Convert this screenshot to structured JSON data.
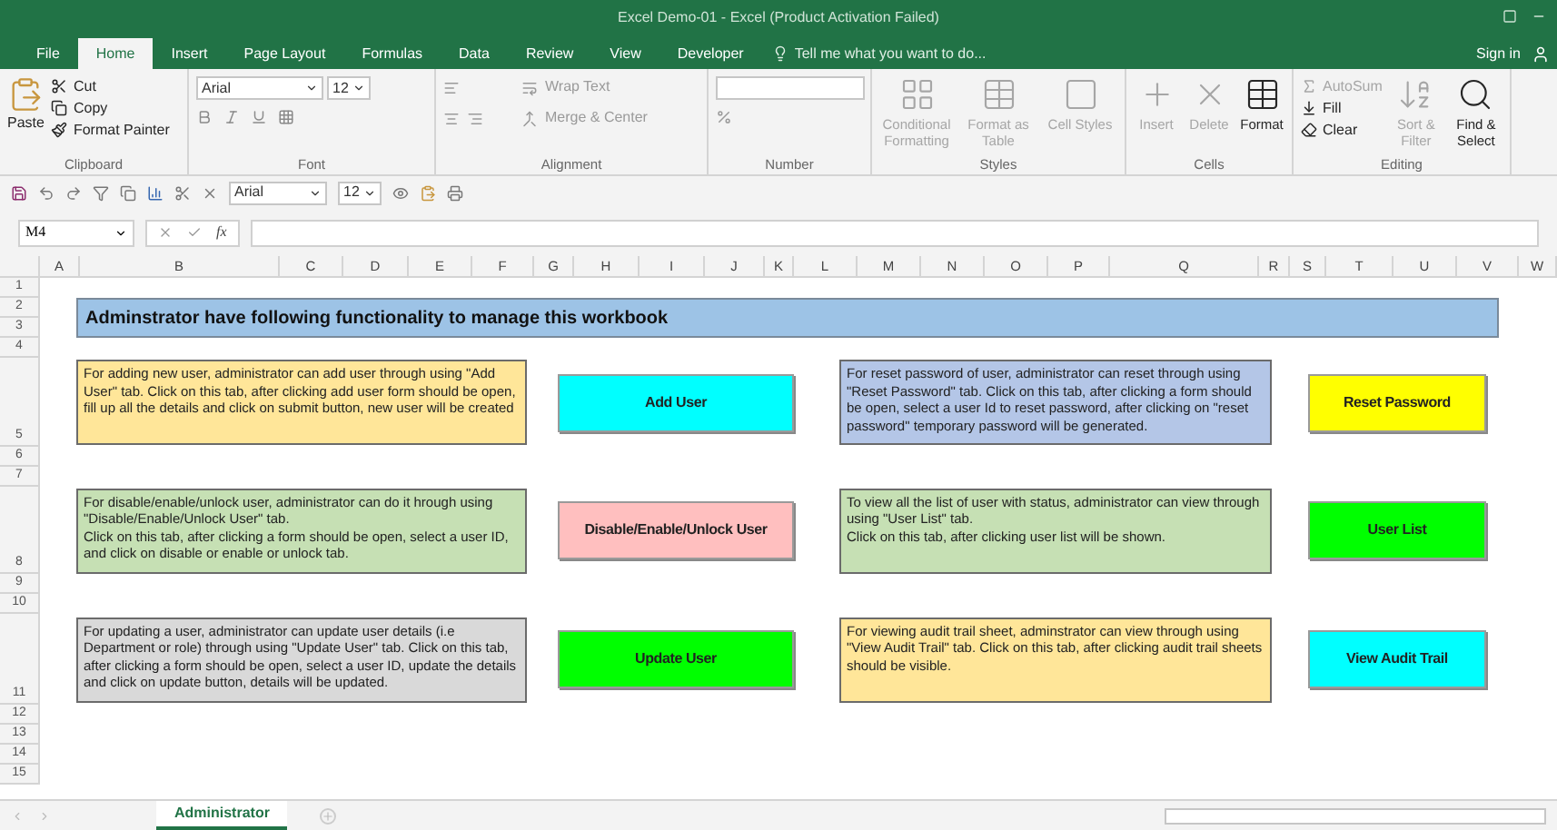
{
  "window": {
    "title": "Excel Demo-01 - Excel (Product Activation Failed)"
  },
  "tabs": [
    {
      "label": "File",
      "selected": false
    },
    {
      "label": "Home",
      "selected": true
    },
    {
      "label": "Insert",
      "selected": false
    },
    {
      "label": "Page Layout",
      "selected": false
    },
    {
      "label": "Formulas",
      "selected": false
    },
    {
      "label": "Data",
      "selected": false
    },
    {
      "label": "Review",
      "selected": false
    },
    {
      "label": "View",
      "selected": false
    },
    {
      "label": "Developer",
      "selected": false
    }
  ],
  "tell_me": {
    "placeholder": "Tell me what you want to do..."
  },
  "sign_in": "Sign in",
  "ribbon": {
    "clipboard": {
      "label": "Clipboard",
      "paste": "Paste",
      "commands": [
        {
          "label": "Cut",
          "disabled": false
        },
        {
          "label": "Copy",
          "disabled": false
        },
        {
          "label": "Format Painter",
          "disabled": false
        }
      ]
    },
    "font": {
      "label": "Font",
      "family": "Arial",
      "size": "12"
    },
    "alignment": {
      "label": "Alignment",
      "wrap": "Wrap Text",
      "merge": "Merge & Center"
    },
    "number": {
      "label": "Number"
    },
    "styles": {
      "label": "Styles",
      "commands": [
        {
          "label": "Conditional Formatting",
          "disabled": true
        },
        {
          "label": "Format as Table",
          "disabled": true
        },
        {
          "label": "Cell Styles",
          "disabled": true
        }
      ]
    },
    "cells": {
      "label": "Cells",
      "commands": [
        {
          "label": "Insert",
          "disabled": true
        },
        {
          "label": "Delete",
          "disabled": true
        },
        {
          "label": "Format",
          "disabled": false
        }
      ]
    },
    "editing": {
      "label": "Editing",
      "small": [
        {
          "label": "AutoSum",
          "disabled": true
        },
        {
          "label": "Fill",
          "disabled": false
        },
        {
          "label": "Clear",
          "disabled": false
        }
      ],
      "large": [
        {
          "label": "Sort & Filter",
          "disabled": true
        },
        {
          "label": "Find & Select",
          "disabled": false
        }
      ]
    }
  },
  "quick_access": {
    "font": "Arial",
    "size": "12"
  },
  "formula_bar": {
    "name_box": "M4",
    "fx": "fx"
  },
  "columns": [
    "A",
    "B",
    "C",
    "D",
    "E",
    "F",
    "G",
    "H",
    "I",
    "J",
    "K",
    "L",
    "M",
    "N",
    "O",
    "P",
    "Q",
    "R",
    "S",
    "T",
    "U",
    "V",
    "W"
  ],
  "rows": [
    "1",
    "2",
    "3",
    "4",
    "5",
    "6",
    "7",
    "8",
    "9",
    "10",
    "11",
    "12",
    "13",
    "14",
    "15"
  ],
  "heading": "Adminstrator have following functionality to manage this workbook",
  "blocks": [
    {
      "left": {
        "text": "For adding new user, administrator can add user through using \"Add User\" tab. Click on this tab, after clicking add user form should be open, fill up all the details and click on submit button, new user will be created",
        "color": "#ffe699",
        "button": {
          "label": "Add User",
          "color": "#00ffff"
        }
      },
      "right": {
        "text": "For reset password of user, administrator can reset through using \"Reset Password\" tab. Click on this tab, after clicking a form should be open, select a user Id to reset password, after clicking on \"reset password\" temporary password will be generated.",
        "color": "#b4c6e7",
        "button": {
          "label": "Reset Password",
          "color": "#ffff00"
        }
      }
    },
    {
      "left": {
        "text": "For disable/enable/unlock user, administrator can do it hrough using \"Disable/Enable/Unlock User\" tab.\nClick on this tab, after clicking a form should be open, select a user ID, and click on disable or enable or unlock tab.",
        "color": "#c6e0b4",
        "button": {
          "label": "Disable/Enable/Unlock User",
          "color": "#ffbfbf"
        }
      },
      "right": {
        "text": "To view all the list of user with status, administrator can view through using \"User List\" tab.\nClick on this tab, after clicking user list will be shown.",
        "color": "#c6e0b4",
        "button": {
          "label": "User List",
          "color": "#00ff00"
        }
      }
    },
    {
      "left": {
        "text": "For updating a user, administrator can update user details (i.e Department or role) through using \"Update User\" tab. Click on this tab, after clicking a form should be open, select a user ID, update the details and click on update button, details will be updated.",
        "color": "#d9d9d9",
        "button": {
          "label": "Update User",
          "color": "#00ff00"
        }
      },
      "right": {
        "text": "For viewing audit trail sheet, adminstrator can view through using \"View Audit Trail\" tab. Click on this tab, after clicking audit trail sheets should be visible.",
        "color": "#ffe699",
        "button": {
          "label": "View Audit Trail",
          "color": "#00ffff"
        }
      }
    }
  ],
  "sheet_tabs": [
    {
      "label": "Administrator",
      "selected": true
    }
  ]
}
